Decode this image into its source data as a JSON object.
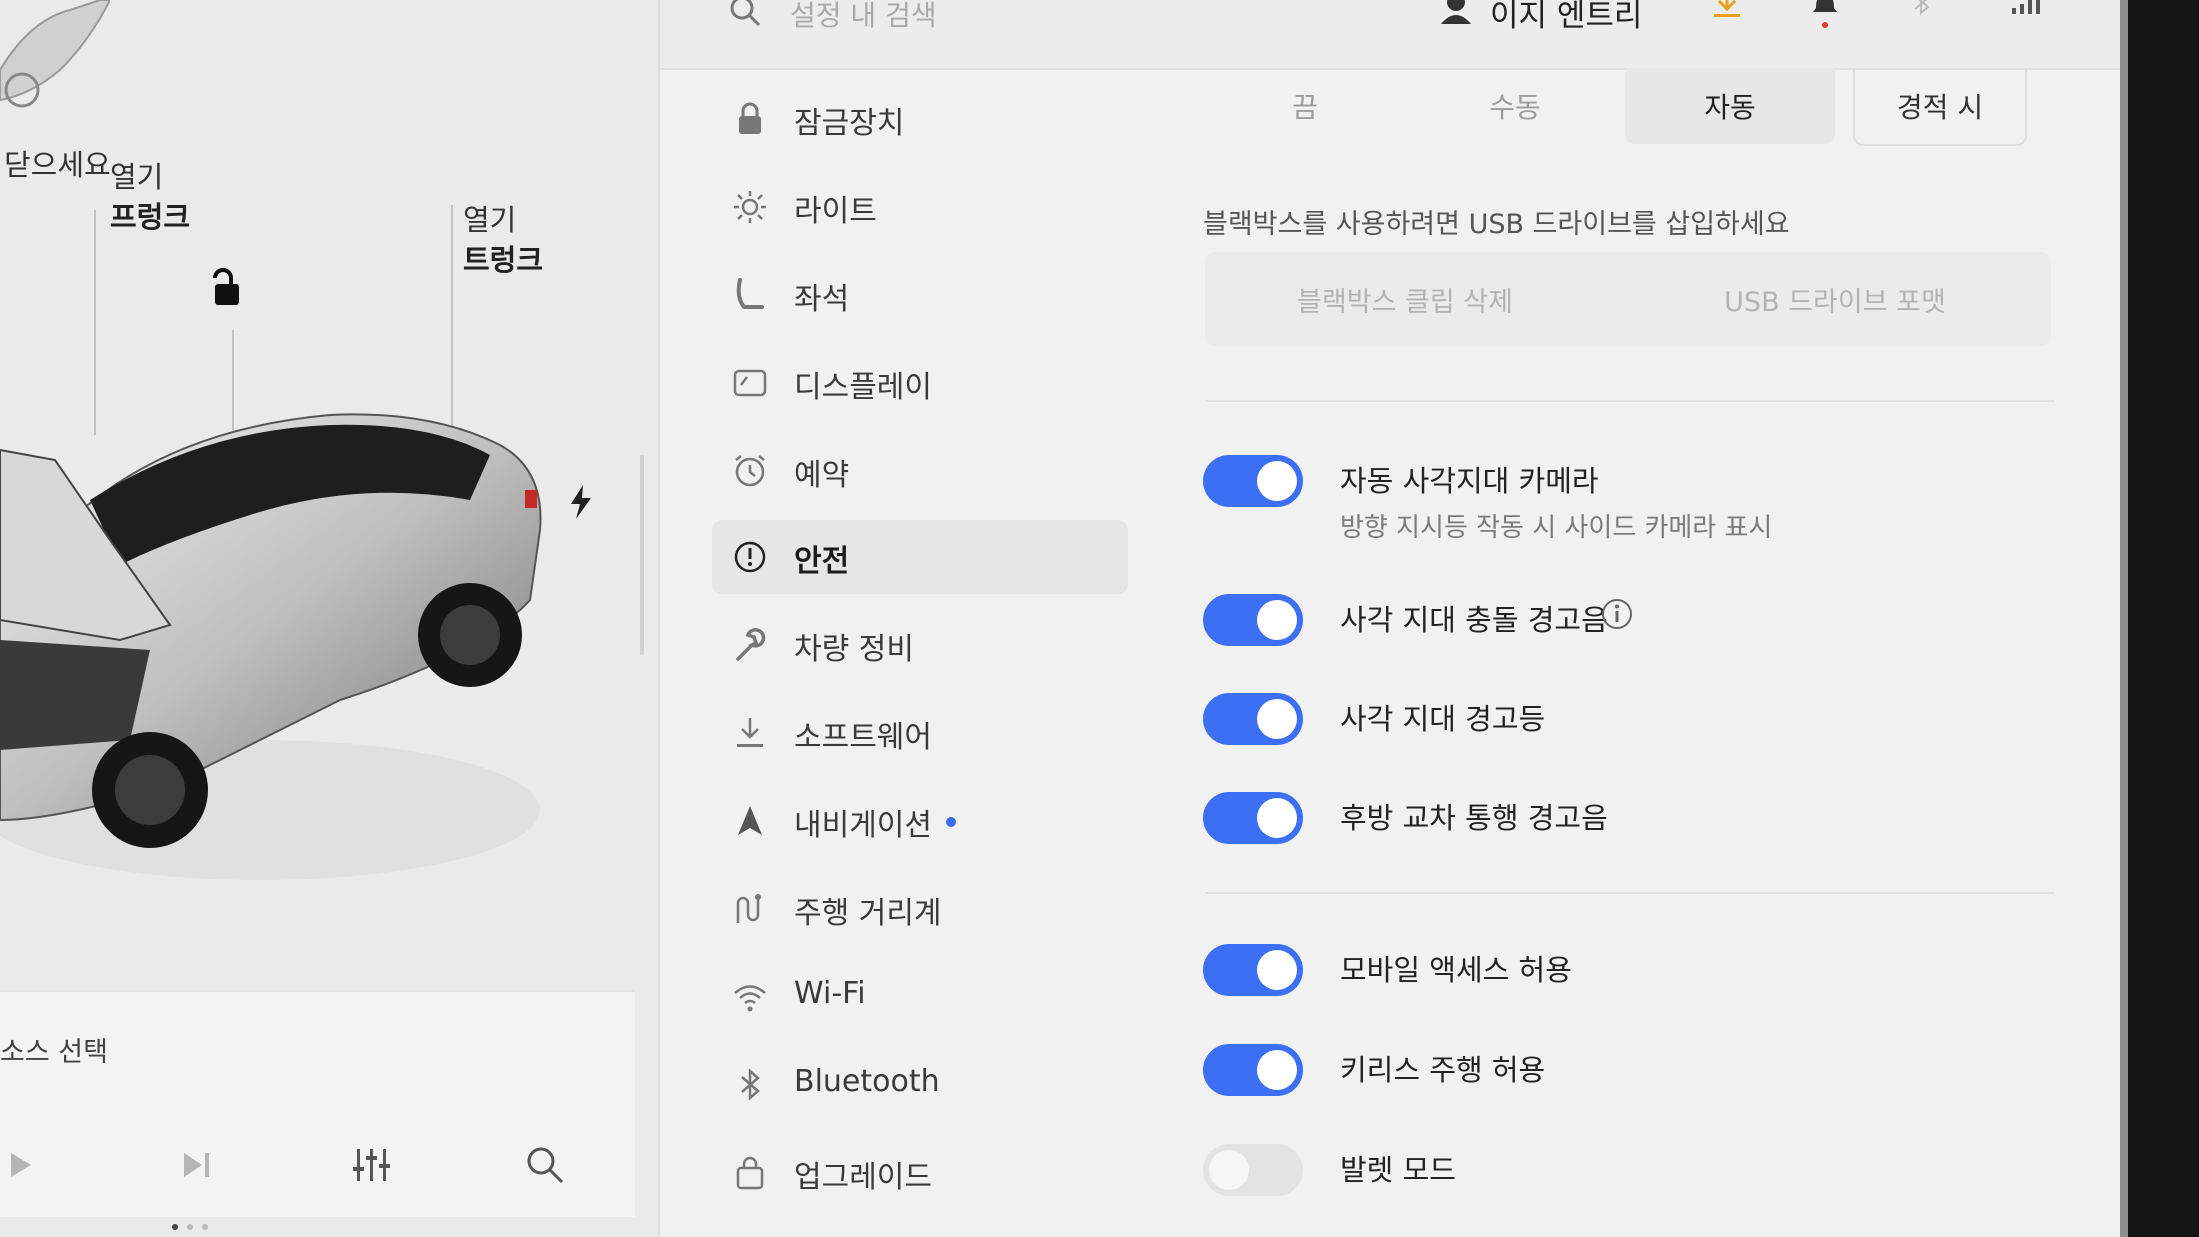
{
  "top_bar": {
    "search_placeholder": "설정 내 검색",
    "profile_name": "이지 엔트리",
    "icons": [
      "search-icon",
      "profile-icon",
      "download-icon",
      "bell-icon",
      "bluetooth-icon",
      "signal-icon"
    ]
  },
  "vehicle": {
    "close_hint": "닫으세요",
    "front_trunk_action": "열기",
    "front_trunk_name": "프렁크",
    "rear_trunk_action": "열기",
    "rear_trunk_name": "트렁크"
  },
  "media": {
    "source_label": "소스 선택",
    "controls": [
      "play-icon",
      "next-icon",
      "equalizer-icon",
      "search-icon"
    ]
  },
  "menu": {
    "items": [
      {
        "label": "잠금장치",
        "icon": "lock-icon"
      },
      {
        "label": "라이트",
        "icon": "light-icon"
      },
      {
        "label": "좌석",
        "icon": "seat-icon"
      },
      {
        "label": "디스플레이",
        "icon": "display-icon"
      },
      {
        "label": "예약",
        "icon": "alarm-icon"
      },
      {
        "label": "안전",
        "icon": "safety-icon",
        "active": true
      },
      {
        "label": "차량 정비",
        "icon": "wrench-icon"
      },
      {
        "label": "소프트웨어",
        "icon": "download-icon"
      },
      {
        "label": "내비게이션",
        "icon": "navigation-icon",
        "has_new_dot": true
      },
      {
        "label": "주행 거리계",
        "icon": "trips-icon"
      },
      {
        "label": "Wi-Fi",
        "icon": "wifi-icon"
      },
      {
        "label": "Bluetooth",
        "icon": "bluetooth-icon"
      },
      {
        "label": "업그레이드",
        "icon": "shopping-bag-icon"
      }
    ]
  },
  "safety": {
    "sentry_modes": [
      "끔",
      "수동",
      "자동",
      "경적 시"
    ],
    "sentry_selected": "자동",
    "dashcam_notice": "블랙박스를 사용하려면 USB 드라이브를 삽입하세요",
    "dashcam_buttons": [
      "블랙박스 클립 삭제",
      "USB 드라이브 포맷"
    ],
    "options": [
      {
        "label": "자동 사각지대 카메라",
        "sub": "방향 지시등 작동 시 사이드 카메라 표시",
        "on": true
      },
      {
        "label": "사각 지대 충돌 경고음",
        "on": true,
        "info": true
      },
      {
        "label": "사각 지대 경고등",
        "on": true
      },
      {
        "label": "후방 교차 통행 경고음",
        "on": true
      },
      {
        "label": "모바일 액세스 허용",
        "on": true
      },
      {
        "label": "키리스 주행 허용",
        "on": true
      },
      {
        "label": "발렛 모드",
        "on": false
      }
    ]
  },
  "colors": {
    "toggle_on": "#3d6ff5",
    "new_dot": "#3b6df0",
    "notification": "#e53935"
  }
}
